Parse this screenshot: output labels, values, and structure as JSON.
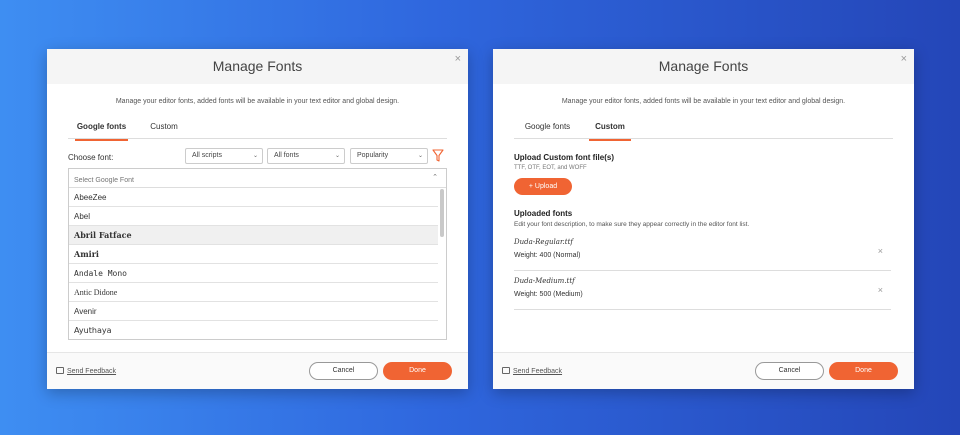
{
  "left_dialog": {
    "title": "Manage Fonts",
    "subtitle": "Manage your editor fonts, added fonts will be available in your text editor and global design.",
    "close_glyph": "×",
    "tabs": [
      {
        "label": "Google fonts",
        "active": true
      },
      {
        "label": "Custom",
        "active": false
      }
    ],
    "choose_label": "Choose font:",
    "filters": {
      "scripts": "All scripts",
      "fonts": "All fonts",
      "sort": "Popularity"
    },
    "search_placeholder": "Select Google Font",
    "fonts": [
      {
        "name": "AbeeZee",
        "family": "Liberation Sans, sans-serif",
        "style": "normal",
        "weight": "normal"
      },
      {
        "name": "Abel",
        "family": "Liberation Sans, sans-serif",
        "style": "normal",
        "weight": "normal"
      },
      {
        "name": "Abril Fatface",
        "family": "DejaVu Serif, serif",
        "style": "normal",
        "weight": "bold",
        "highlighted": true
      },
      {
        "name": "Amiri",
        "family": "DejaVu Serif, serif",
        "style": "normal",
        "weight": "bold"
      },
      {
        "name": "Andale Mono",
        "family": "DejaVu Sans Mono, monospace",
        "style": "normal",
        "weight": "normal"
      },
      {
        "name": "Antic Didone",
        "family": "Liberation Serif, serif",
        "style": "normal",
        "weight": "normal"
      },
      {
        "name": "Avenir",
        "family": "Liberation Sans, sans-serif",
        "style": "normal",
        "weight": "normal"
      },
      {
        "name": "Ayuthaya",
        "family": "DejaVu Sans, sans-serif",
        "style": "normal",
        "weight": "normal"
      }
    ],
    "footer": {
      "feedback": "Send Feedback",
      "cancel": "Cancel",
      "done": "Done"
    }
  },
  "right_dialog": {
    "title": "Manage Fonts",
    "subtitle": "Manage your editor fonts, added fonts will be available in your text editor and global design.",
    "close_glyph": "×",
    "tabs": [
      {
        "label": "Google fonts",
        "active": false
      },
      {
        "label": "Custom",
        "active": true
      }
    ],
    "upload": {
      "title": "Upload Custom font file(s)",
      "formats": "TTF, OTF, EOT, and WOFF",
      "button": "Upload",
      "plus": "+"
    },
    "uploaded": {
      "title": "Uploaded fonts",
      "description": "Edit your font description, to make sure they appear correctly in the editor font list.",
      "files": [
        {
          "name": "Duda-Regular.ttf",
          "weight": "Weight: 400 (Normal)"
        },
        {
          "name": "Duda-Medium.ttf",
          "weight": "Weight: 500 (Medium)"
        }
      ],
      "remove_glyph": "×"
    },
    "footer": {
      "feedback": "Send Feedback",
      "cancel": "Cancel",
      "done": "Done"
    }
  },
  "colors": {
    "accent": "#f06433",
    "background_start": "#3e8ef2",
    "background_end": "#2446b8"
  }
}
